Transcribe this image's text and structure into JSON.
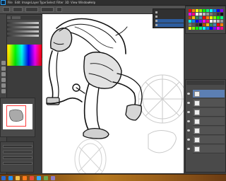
{
  "app": {
    "name": "Adobe Photoshop",
    "menus": [
      "File",
      "Edit",
      "Image",
      "Layer",
      "Type",
      "Select",
      "Filter",
      "3D",
      "View",
      "Window",
      "Help"
    ]
  },
  "colors": {
    "ui_dark": "#3c3c3c",
    "panel": "#4a4a4a",
    "accent": "#2d5d9f",
    "taskbar": "#b5781f"
  },
  "history_popup": {
    "items": [
      {
        "label": "",
        "selected": false
      },
      {
        "label": "",
        "selected": false
      },
      {
        "label": "",
        "selected": true
      },
      {
        "label": "",
        "selected": true
      }
    ]
  },
  "layers": {
    "items": [
      {
        "name": "",
        "active": true
      },
      {
        "name": "",
        "active": false
      },
      {
        "name": "",
        "active": false
      },
      {
        "name": "",
        "active": false
      },
      {
        "name": "",
        "active": false
      },
      {
        "name": "",
        "active": false
      },
      {
        "name": "",
        "active": false
      }
    ]
  },
  "canvas": {
    "content": "line sketch"
  },
  "taskbar": {
    "icons": [
      "start-icon",
      "ie-icon",
      "folder-icon",
      "media-icon",
      "chrome-icon",
      "photoshop-icon",
      "mail-icon",
      "misc-icon"
    ],
    "clock": ""
  }
}
